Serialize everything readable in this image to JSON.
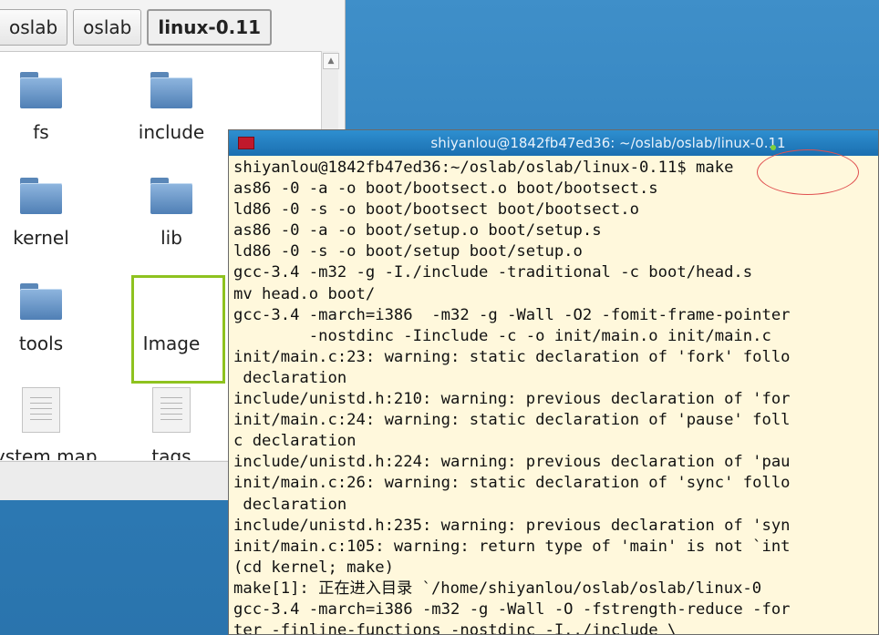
{
  "file_manager": {
    "breadcrumbs": [
      "oslab",
      "oslab",
      "linux-0.11"
    ],
    "items": [
      {
        "name": "fs",
        "icon": "folder-icon"
      },
      {
        "name": "include",
        "icon": "folder-icon"
      },
      {
        "name": "kernel",
        "icon": "folder-icon"
      },
      {
        "name": "lib",
        "icon": "folder-icon"
      },
      {
        "name": "tools",
        "icon": "folder-icon"
      },
      {
        "name": "Image",
        "icon": "none",
        "selected": true
      },
      {
        "name": "system.map",
        "icon": "document-icon"
      },
      {
        "name": "tags",
        "icon": "document-icon"
      }
    ]
  },
  "terminal": {
    "title": "shiyanlou@1842fb47ed36: ~/oslab/oslab/linux-0.11",
    "lines": [
      "shiyanlou@1842fb47ed36:~/oslab/oslab/linux-0.11$ make",
      "as86 -0 -a -o boot/bootsect.o boot/bootsect.s",
      "ld86 -0 -s -o boot/bootsect boot/bootsect.o",
      "as86 -0 -a -o boot/setup.o boot/setup.s",
      "ld86 -0 -s -o boot/setup boot/setup.o",
      "gcc-3.4 -m32 -g -I./include -traditional -c boot/head.s",
      "mv head.o boot/",
      "gcc-3.4 -march=i386  -m32 -g -Wall -O2 -fomit-frame-pointer",
      "        -nostdinc -Iinclude -c -o init/main.o init/main.c",
      "init/main.c:23: warning: static declaration of 'fork' follo",
      " declaration",
      "include/unistd.h:210: warning: previous declaration of 'for",
      "init/main.c:24: warning: static declaration of 'pause' foll",
      "c declaration",
      "include/unistd.h:224: warning: previous declaration of 'pau",
      "init/main.c:26: warning: static declaration of 'sync' follo",
      " declaration",
      "include/unistd.h:235: warning: previous declaration of 'syn",
      "init/main.c:105: warning: return type of 'main' is not `int",
      "(cd kernel; make)",
      "make[1]: 正在进入目录 `/home/shiyanlou/oslab/oslab/linux-0",
      "gcc-3.4 -march=i386 -m32 -g -Wall -O -fstrength-reduce -for",
      "ter -finline-functions -nostdinc -I../include \\"
    ]
  },
  "colors": {
    "desktop": "#2f7fbb",
    "terminal_bg": "#fff8dc",
    "titlebar": "#1b6fb0",
    "selection": "#8ec21f",
    "annotation": "#e05050"
  }
}
